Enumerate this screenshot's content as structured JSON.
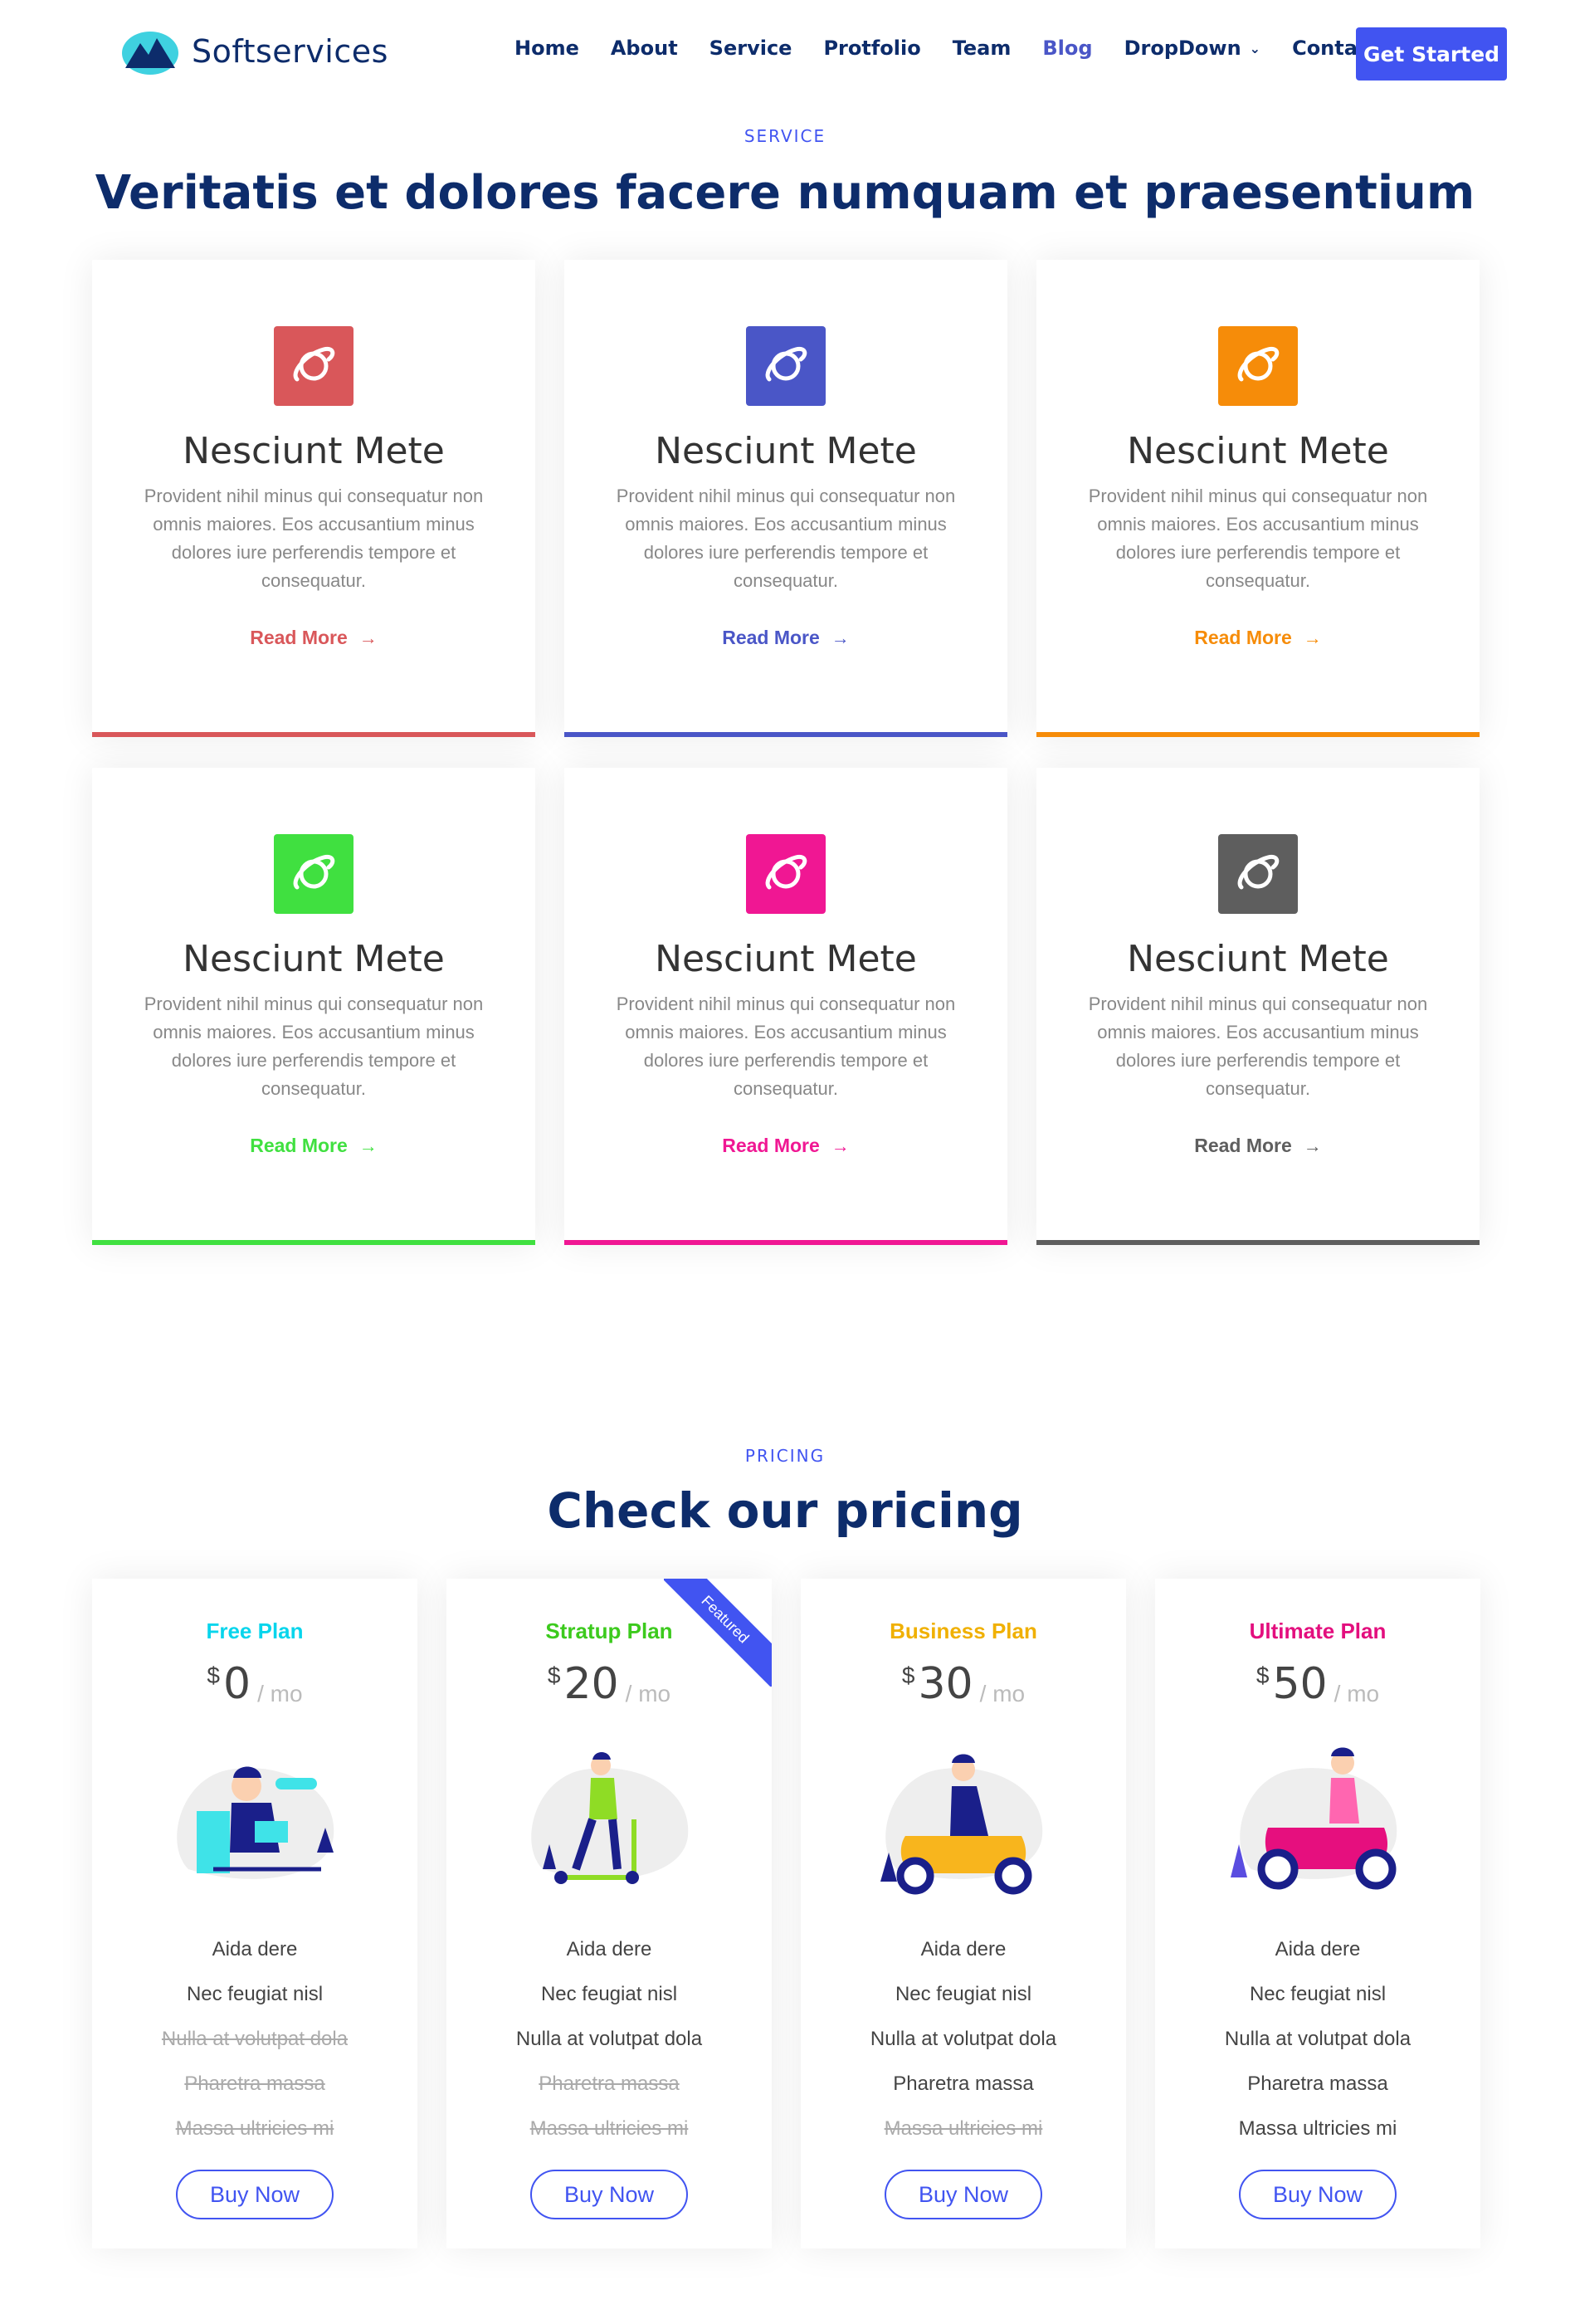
{
  "header": {
    "brand": "Softservices",
    "nav": [
      "Home",
      "About",
      "Service",
      "Protfolio",
      "Team",
      "Blog",
      "DropDown",
      "Contact"
    ],
    "active_nav": "Blog",
    "cta": "Get Started"
  },
  "services": {
    "label": "SERVICE",
    "title": "Veritatis et dolores facere numquam et praesentium",
    "items": [
      {
        "title": "Nesciunt Mete",
        "text": "Provident nihil minus qui consequatur non omnis maiores. Eos accusantium minus dolores iure perferendis tempore et consequatur.",
        "link": "Read More",
        "color": "#d9575a",
        "icon": "planet-icon"
      },
      {
        "title": "Nesciunt Mete",
        "text": "Provident nihil minus qui consequatur non omnis maiores. Eos accusantium minus dolores iure perferendis tempore et consequatur.",
        "link": "Read More",
        "color": "#4a56c7",
        "icon": "planet-icon"
      },
      {
        "title": "Nesciunt Mete",
        "text": "Provident nihil minus qui consequatur non omnis maiores. Eos accusantium minus dolores iure perferendis tempore et consequatur.",
        "link": "Read More",
        "color": "#f68c09",
        "icon": "planet-icon"
      },
      {
        "title": "Nesciunt Mete",
        "text": "Provident nihil minus qui consequatur non omnis maiores. Eos accusantium minus dolores iure perferendis tempore et consequatur.",
        "link": "Read More",
        "color": "#40e040",
        "icon": "planet-icon"
      },
      {
        "title": "Nesciunt Mete",
        "text": "Provident nihil minus qui consequatur non omnis maiores. Eos accusantium minus dolores iure perferendis tempore et consequatur.",
        "link": "Read More",
        "color": "#f01793",
        "icon": "planet-icon"
      },
      {
        "title": "Nesciunt Mete",
        "text": "Provident nihil minus qui consequatur non omnis maiores. Eos accusantium minus dolores iure perferendis tempore et consequatur.",
        "link": "Read More",
        "color": "#5e5e5e",
        "icon": "planet-icon"
      }
    ]
  },
  "pricing": {
    "label": "PRICING",
    "title": "Check our pricing",
    "plans": [
      {
        "name": "Free Plan",
        "color": "#07d5ec",
        "currency": "$",
        "amount": "0",
        "period": "/ mo",
        "featured": false,
        "illustration": "person-at-desk-illustration",
        "buy": "Buy Now",
        "features": [
          {
            "text": "Aida dere",
            "available": true
          },
          {
            "text": "Nec feugiat nisl",
            "available": true
          },
          {
            "text": "Nulla at volutpat dola",
            "available": false
          },
          {
            "text": "Pharetra massa",
            "available": false
          },
          {
            "text": "Massa ultricies mi",
            "available": false
          }
        ]
      },
      {
        "name": "Stratup Plan",
        "color": "#3cca1d",
        "currency": "$",
        "amount": "20",
        "period": "/ mo",
        "featured": true,
        "ribbon": "Featured",
        "illustration": "scooter-rider-illustration",
        "buy": "Buy Now",
        "features": [
          {
            "text": "Aida dere",
            "available": true
          },
          {
            "text": "Nec feugiat nisl",
            "available": true
          },
          {
            "text": "Nulla at volutpat dola",
            "available": true
          },
          {
            "text": "Pharetra massa",
            "available": false
          },
          {
            "text": "Massa ultricies mi",
            "available": false
          }
        ]
      },
      {
        "name": "Business Plan",
        "color": "#f0b000",
        "currency": "$",
        "amount": "30",
        "period": "/ mo",
        "featured": false,
        "illustration": "moped-rider-illustration",
        "buy": "Buy Now",
        "features": [
          {
            "text": "Aida dere",
            "available": true
          },
          {
            "text": "Nec feugiat nisl",
            "available": true
          },
          {
            "text": "Nulla at volutpat dola",
            "available": true
          },
          {
            "text": "Pharetra massa",
            "available": true
          },
          {
            "text": "Massa ultricies mi",
            "available": false
          }
        ]
      },
      {
        "name": "Ultimate Plan",
        "color": "#e30f7e",
        "currency": "$",
        "amount": "50",
        "period": "/ mo",
        "featured": false,
        "illustration": "motorbike-rider-illustration",
        "buy": "Buy Now",
        "features": [
          {
            "text": "Aida dere",
            "available": true
          },
          {
            "text": "Nec feugiat nisl",
            "available": true
          },
          {
            "text": "Nulla at volutpat dola",
            "available": true
          },
          {
            "text": "Pharetra massa",
            "available": true
          },
          {
            "text": "Massa ultricies mi",
            "available": true
          }
        ]
      }
    ]
  }
}
